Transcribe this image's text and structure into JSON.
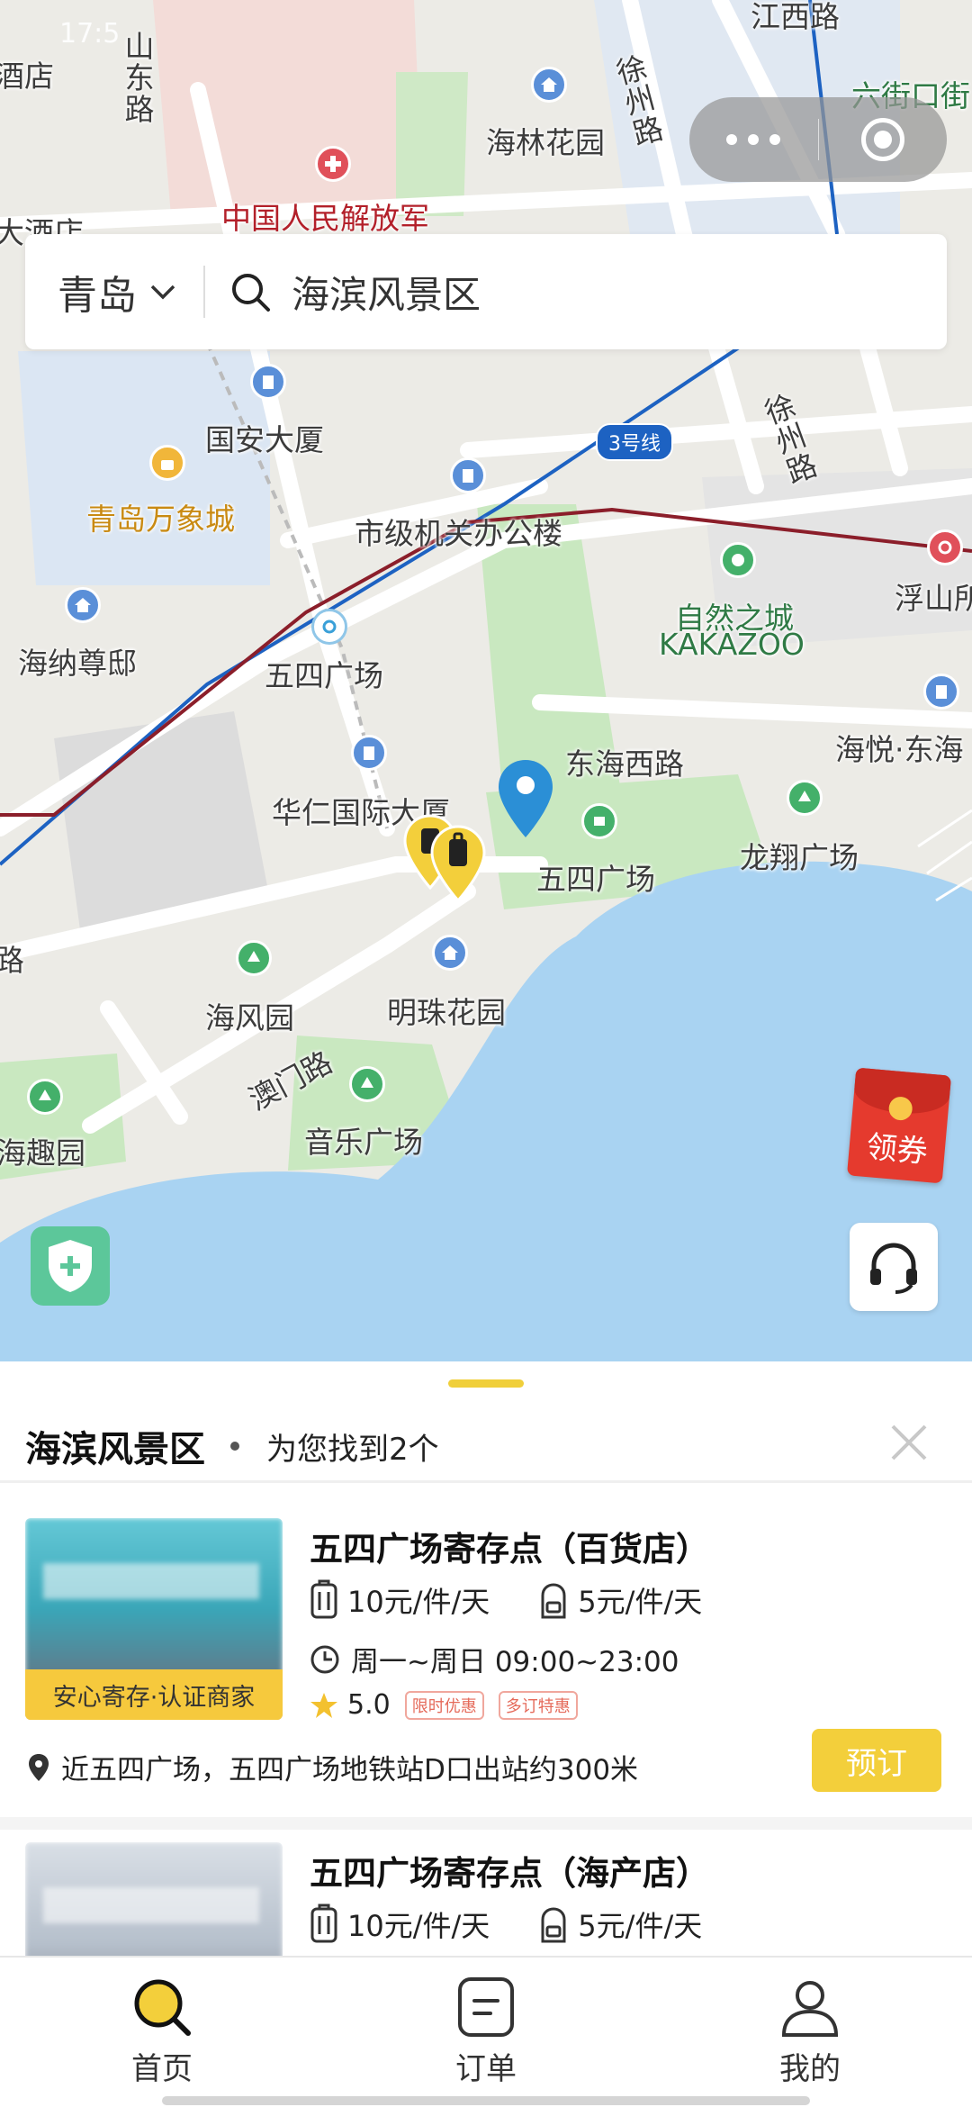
{
  "status_bar": {
    "time": "17:5"
  },
  "search": {
    "city": "青岛",
    "query": "海滨风景区"
  },
  "map": {
    "labels": {
      "jiangxi_road": "江西路",
      "liujie": "六街口街",
      "shandong_road": "山东路",
      "dian": "酒店",
      "dajiudian": "大酒店",
      "pla": "中国人民解放军",
      "hailin": "海林花园",
      "xuzhou_road_top": "徐州路",
      "xuzhou_road_mid": "徐州路",
      "guoan": "国安大厦",
      "wanxiang": "青岛万象城",
      "line3": "3号线",
      "city_office": "市级机关办公楼",
      "fushan": "浮山所",
      "ziran": "自然之城",
      "kakazoo": "KAKAZOO",
      "haina": "海纳尊邸",
      "wusi_station": "五四广场",
      "haiyue": "海悦·东海",
      "donghai_west": "东海西路",
      "huaren": "华仁国际大厦",
      "wusi_square": "五四广场",
      "longxiang": "龙翔广场",
      "haifeng": "海风园",
      "mingzhu": "明珠花园",
      "aomen_road": "澳门路",
      "yinyue": "音乐广场",
      "haiqu": "海趣园",
      "lu": "路"
    },
    "coupon_label": "领券"
  },
  "sheet": {
    "title": "海滨风景区",
    "result_count": "为您找到2个"
  },
  "results": [
    {
      "name": "五四广场寄存点（百货店）",
      "price_luggage": "10元/件/天",
      "price_bag": "5元/件/天",
      "hours": "周一~周日 09:00~23:00",
      "rating": "5.0",
      "tags": [
        "限时优惠",
        "多订特惠"
      ],
      "badge": "安心寄存·认证商家",
      "address": "近五四广场，五四广场地铁站D口出站约300米",
      "action": "预订"
    },
    {
      "name": "五四广场寄存点（海产店）",
      "price_luggage": "10元/件/天",
      "price_bag": "5元/件/天"
    }
  ],
  "tabs": {
    "home": "首页",
    "orders": "订单",
    "profile": "我的"
  },
  "colors": {
    "accent": "#F3CF3B",
    "sea": "#A9D3F2",
    "park": "#C9E8C0",
    "metro_line3": "#1D62C2",
    "metro_red": "#8B1E2A"
  }
}
